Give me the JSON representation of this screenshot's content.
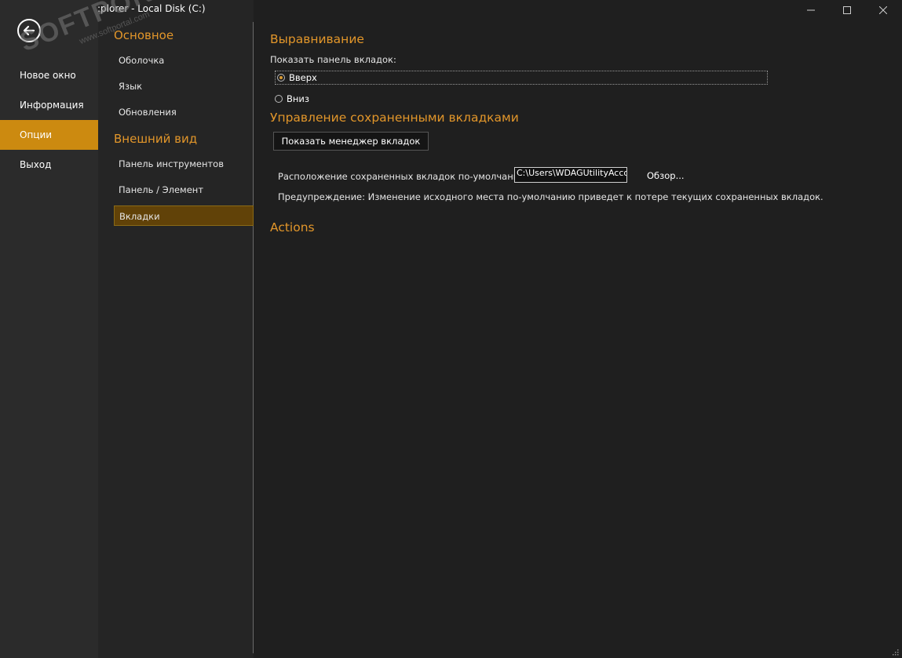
{
  "window": {
    "title": ":plorer - Local Disk (C:)",
    "minimize_glyph": "—",
    "maximize_glyph": "☐",
    "close_glyph": "✕"
  },
  "nav": {
    "back_icon": "arrow-left-icon",
    "items": [
      {
        "label": "Новое окно"
      },
      {
        "label": "Информация"
      },
      {
        "label": "Опции",
        "active": true
      },
      {
        "label": "Выход"
      }
    ]
  },
  "submenu": {
    "section_general": "Основное",
    "general_items": [
      "Оболочка",
      "Язык",
      "Обновления"
    ],
    "section_appearance": "Внешний вид",
    "appearance_items": [
      "Панель инструментов",
      "Панель / Элемент",
      "Вкладки"
    ],
    "active_item": "Вкладки"
  },
  "content": {
    "alignment_heading": "Выравнивание",
    "show_tabbar_label": "Показать панель вкладок:",
    "radio_top": "Вверх",
    "radio_bottom": "Вниз",
    "radio_selected": "Вверх",
    "saved_tabs_heading": "Управление сохраненными вкладками",
    "show_manager_button": "Показать менеджер вкладок",
    "location_label": "Расположение сохраненных вкладок по-умолчанию:",
    "location_value": "C:\\Users\\WDAGUtilityAcco",
    "browse_label": "Обзор...",
    "warning_text": "Предупреждение: Изменение исходного места по-умолчанию приведет к потере текущих сохраненных вкладок.",
    "actions_heading": "Actions"
  },
  "watermark": {
    "main": "SOFTPORTAL",
    "tm": "™",
    "url": "www.softportal.com"
  },
  "colors": {
    "accent": "#cc8a10",
    "heading": "#e2962a",
    "selected_bg": "#614208"
  }
}
